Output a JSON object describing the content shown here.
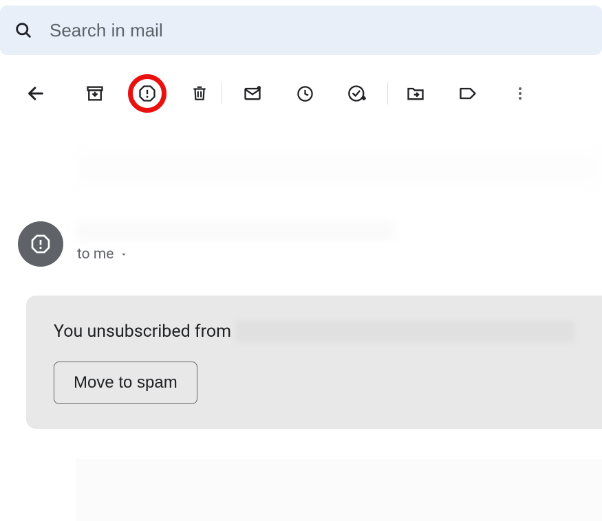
{
  "search": {
    "placeholder": "Search in mail"
  },
  "toolbar": {
    "back": "Back",
    "archive": "Archive",
    "report_spam": "Report spam",
    "delete": "Delete",
    "mark_unread": "Mark as unread",
    "snooze": "Snooze",
    "add_to_tasks": "Add to tasks",
    "move_to": "Move to",
    "labels": "Labels",
    "more": "More"
  },
  "message": {
    "recipient_prefix": "to me"
  },
  "banner": {
    "text": "You unsubscribed from",
    "button": "Move to spam"
  }
}
